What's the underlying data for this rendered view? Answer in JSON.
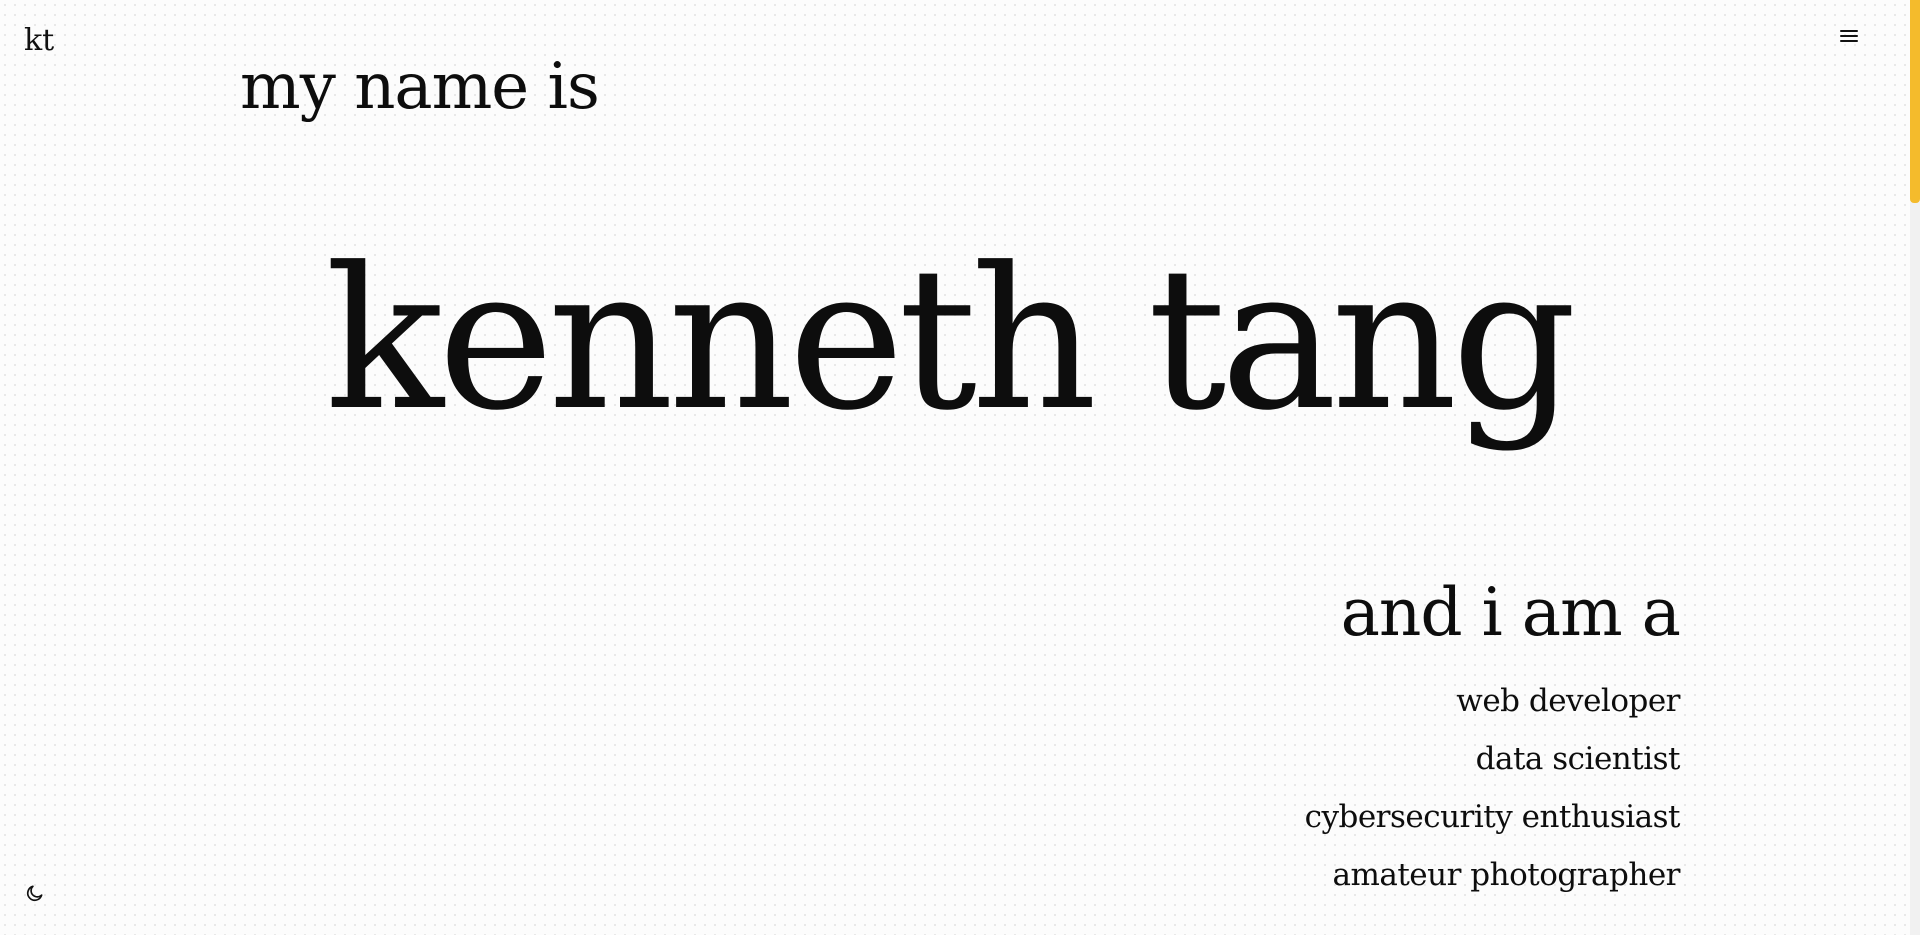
{
  "header": {
    "logo_text": "kt",
    "menu_icon": "hamburger-icon"
  },
  "hero": {
    "intro": "my name is",
    "name": "kenneth tang",
    "tagline": "and i am a",
    "roles": [
      "web developer",
      "data scientist",
      "cybersecurity enthusiast",
      "amateur photographer"
    ]
  },
  "footer": {
    "theme_toggle_icon": "moon-icon"
  },
  "colors": {
    "background": "#fcfcfc",
    "text": "#0d0d0d",
    "scrollbar_accent": "#f4bb2c"
  }
}
